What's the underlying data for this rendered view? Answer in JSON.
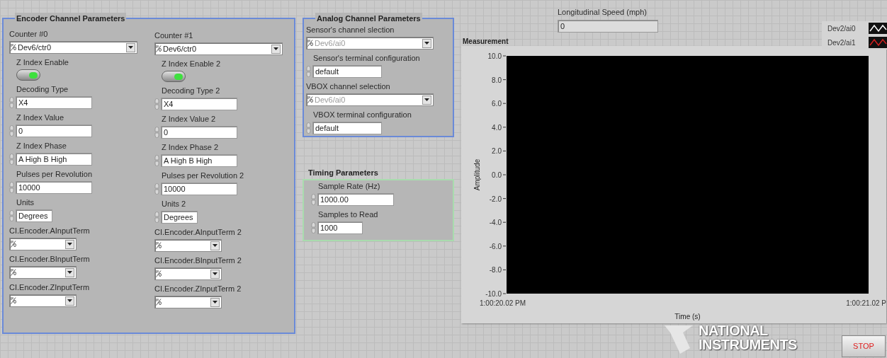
{
  "encoder": {
    "title": "Encoder Channel Parameters",
    "columns": [
      {
        "controls": [
          {
            "kind": "io",
            "label": "Counter #0",
            "value": "Dev6/ctr0",
            "disabled": false
          },
          {
            "kind": "toggle",
            "label": "Z Index Enable",
            "on": true
          },
          {
            "kind": "enum",
            "label": "Decoding Type",
            "value": "X4"
          },
          {
            "kind": "numeric",
            "label": "Z Index Value",
            "value": "0"
          },
          {
            "kind": "enum",
            "label": "Z Index Phase",
            "value": "A High B High"
          },
          {
            "kind": "numeric",
            "label": "Pulses per Revolution",
            "value": "10000"
          },
          {
            "kind": "ring",
            "label": "Units",
            "value": "Degrees"
          },
          {
            "kind": "io",
            "label": "CI.Encoder.AInputTerm"
          },
          {
            "kind": "io",
            "label": "CI.Encoder.BInputTerm"
          },
          {
            "kind": "io",
            "label": "CI.Encoder.ZInputTerm"
          }
        ]
      },
      {
        "controls": [
          {
            "kind": "io",
            "label": "Counter #1",
            "value": "Dev6/ctr0",
            "disabled": false
          },
          {
            "kind": "toggle",
            "label": "Z Index Enable 2",
            "on": true
          },
          {
            "kind": "enum",
            "label": "Decoding Type 2",
            "value": "X4"
          },
          {
            "kind": "numeric",
            "label": "Z Index Value 2",
            "value": "0"
          },
          {
            "kind": "enum",
            "label": "Z Index Phase 2",
            "value": "A High B High"
          },
          {
            "kind": "numeric",
            "label": "Pulses per Revolution 2",
            "value": "10000"
          },
          {
            "kind": "ring",
            "label": "Units 2",
            "value": "Degrees"
          },
          {
            "kind": "io",
            "label": "CI.Encoder.AInputTerm 2"
          },
          {
            "kind": "io",
            "label": "CI.Encoder.BInputTerm 2"
          },
          {
            "kind": "io",
            "label": "CI.Encoder.ZInputTerm 2"
          }
        ]
      }
    ]
  },
  "analog": {
    "title": "Analog Channel Parameters",
    "controls": [
      {
        "kind": "io",
        "label": "Sensor's channel slection",
        "value": "Dev6/ai0",
        "disabled": true
      },
      {
        "kind": "enum",
        "label": "Sensor's terminal configuration",
        "value": "default"
      },
      {
        "kind": "io",
        "label": "VBOX channel selection",
        "value": "Dev6/ai0",
        "disabled": true
      },
      {
        "kind": "enum",
        "label": "VBOX terminal configuration",
        "value": "default"
      }
    ]
  },
  "timing": {
    "title": "Timing Parameters",
    "controls": [
      {
        "kind": "numeric",
        "label": "Sample Rate (Hz)",
        "value": "1000.00"
      },
      {
        "kind": "ring",
        "label": "Samples to Read",
        "value": "1000"
      }
    ]
  },
  "speed": {
    "label": "Longitudinal Speed (mph)",
    "value": "0"
  },
  "graph": {
    "title": "Measurement",
    "legend": [
      {
        "name": "Dev2/ai0",
        "color": "#ffffff"
      },
      {
        "name": "Dev2/ai1",
        "color": "#d02020"
      }
    ],
    "chart_data": {
      "type": "line",
      "xlabel": "Time (s)",
      "ylabel": "Amplitude",
      "ylim": [
        -10,
        10
      ],
      "categories": [
        "1:00:20.02 PM",
        "1:00:21.02 P"
      ],
      "yticks": [
        {
          "value": 10,
          "label": "10.0"
        },
        {
          "value": 8,
          "label": "8.0"
        },
        {
          "value": 6,
          "label": "6.0"
        },
        {
          "value": 4,
          "label": "4.0"
        },
        {
          "value": 2,
          "label": "2.0"
        },
        {
          "value": 0,
          "label": "0.0"
        },
        {
          "value": -2,
          "label": "-2.0"
        },
        {
          "value": -4,
          "label": "-4.0"
        },
        {
          "value": -6,
          "label": "-6.0"
        },
        {
          "value": -8,
          "label": "-8.0"
        },
        {
          "value": -10,
          "label": "-10.0"
        }
      ]
    }
  },
  "logo": {
    "lines": [
      "NATIONAL",
      "INSTRUMENTS"
    ]
  },
  "stop_button": {
    "label": "STOP"
  }
}
